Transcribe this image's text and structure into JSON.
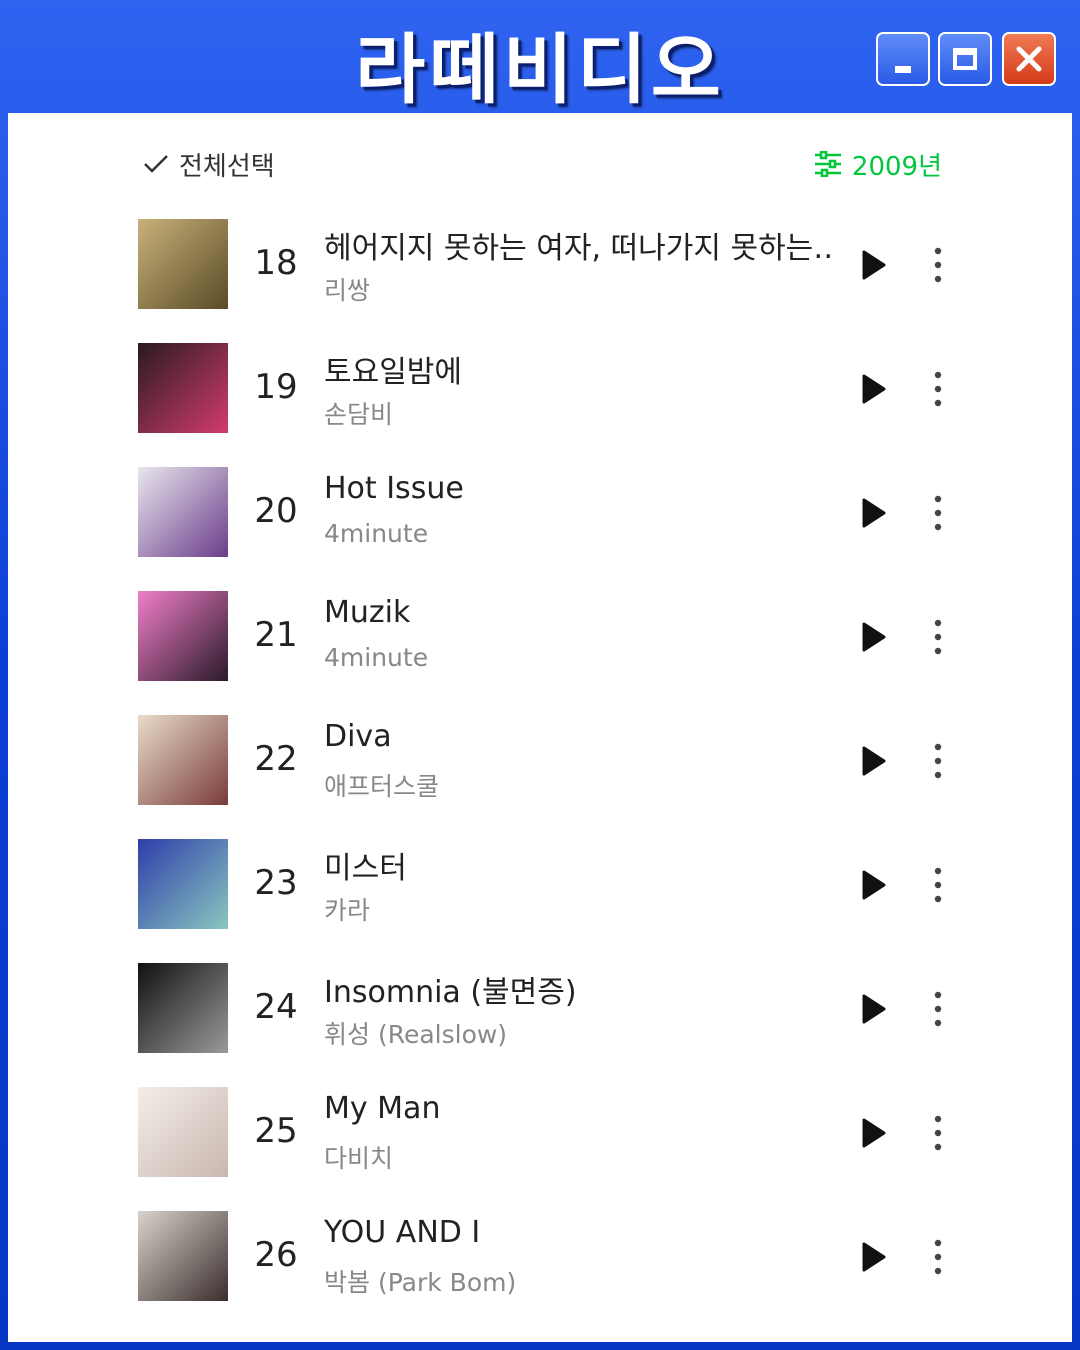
{
  "window": {
    "title": "라떼비디오",
    "controls": {
      "minimize": "minimize",
      "maximize": "maximize",
      "close": "close"
    }
  },
  "toolbar": {
    "select_all_label": "전체선택",
    "filter_year_label": "2009년",
    "accent_color": "#00c73c"
  },
  "songs": [
    {
      "rank": "18",
      "title": "헤어지지 못하는 여자, 떠나가지 못하는…",
      "artist": "리쌍",
      "cover_colors": [
        "#c8b27a",
        "#5a4a26"
      ]
    },
    {
      "rank": "19",
      "title": "토요일밤에",
      "artist": "손담비",
      "cover_colors": [
        "#2a1a22",
        "#d23c6c"
      ]
    },
    {
      "rank": "20",
      "title": "Hot Issue",
      "artist": "4minute",
      "cover_colors": [
        "#e9e6ee",
        "#6a3d8a"
      ]
    },
    {
      "rank": "21",
      "title": "Muzik",
      "artist": "4minute",
      "cover_colors": [
        "#f07fc8",
        "#2a1a2a"
      ]
    },
    {
      "rank": "22",
      "title": "Diva",
      "artist": "애프터스쿨",
      "cover_colors": [
        "#e8dccb",
        "#7a3b3b"
      ]
    },
    {
      "rank": "23",
      "title": "미스터",
      "artist": "카라",
      "cover_colors": [
        "#2e3ea8",
        "#8ac6c0"
      ]
    },
    {
      "rank": "24",
      "title": "Insomnia (불면증)",
      "artist": "휘성 (Realslow)",
      "cover_colors": [
        "#111111",
        "#9a9a9a"
      ]
    },
    {
      "rank": "25",
      "title": "My Man",
      "artist": "다비치",
      "cover_colors": [
        "#f3ede8",
        "#c9b8b0"
      ]
    },
    {
      "rank": "26",
      "title": "YOU AND I",
      "artist": "박봄 (Park Bom)",
      "cover_colors": [
        "#d9d2cc",
        "#3a2e2c"
      ]
    }
  ]
}
